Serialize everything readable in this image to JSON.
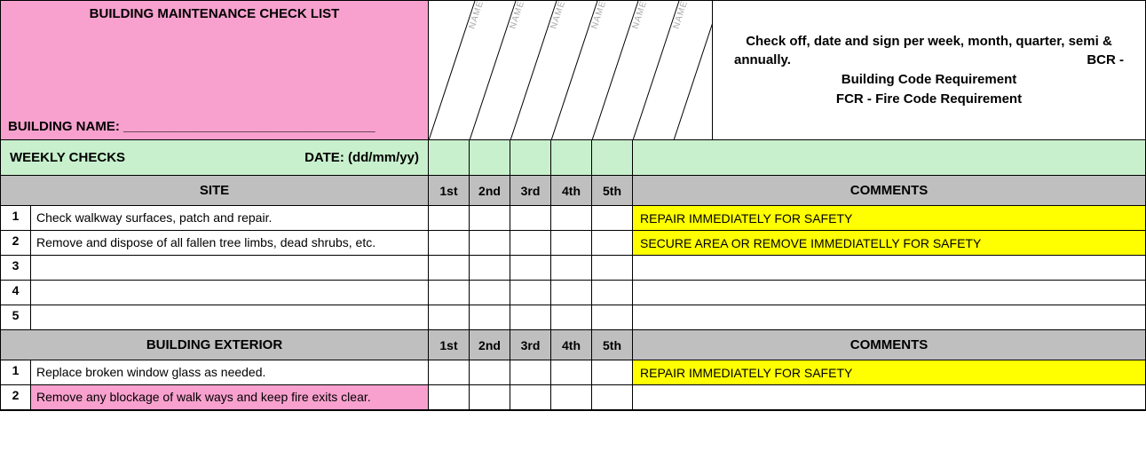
{
  "header": {
    "title": "BUILDING MAINTENANCE CHECK LIST",
    "building_label": "BUILDING NAME: __________________________________",
    "name_label": "NAME",
    "info_line1_left": "Check off, date and sign per week, month, quarter, semi &",
    "info_line2_left": "annually.",
    "info_line2_right": "BCR -",
    "info_line3": "Building Code Requirement",
    "info_line4": "FCR - Fire Code Requirement"
  },
  "weekly": {
    "label": "WEEKLY CHECKS",
    "date_label": "DATE: (dd/mm/yy)"
  },
  "columns": [
    "1st",
    "2nd",
    "3rd",
    "4th",
    "5th"
  ],
  "comments_header": "COMMENTS",
  "sections": [
    {
      "title": "SITE",
      "rows": [
        {
          "num": "1",
          "desc": "Check walkway surfaces, patch and repair.",
          "comment": "REPAIR IMMEDIATELY FOR SAFETY",
          "comment_yellow": true,
          "desc_pink": false
        },
        {
          "num": "2",
          "desc": "Remove and dispose of all fallen tree limbs, dead shrubs, etc.",
          "comment": "SECURE AREA OR REMOVE IMMEDIATELLY FOR SAFETY",
          "comment_yellow": true,
          "desc_pink": false
        },
        {
          "num": "3",
          "desc": "",
          "comment": "",
          "comment_yellow": false,
          "desc_pink": false
        },
        {
          "num": "4",
          "desc": "",
          "comment": "",
          "comment_yellow": false,
          "desc_pink": false
        },
        {
          "num": "5",
          "desc": "",
          "comment": "",
          "comment_yellow": false,
          "desc_pink": false
        }
      ]
    },
    {
      "title": "BUILDING EXTERIOR",
      "rows": [
        {
          "num": "1",
          "desc": "Replace broken window glass as needed.",
          "comment": "REPAIR IMMEDIATELY FOR SAFETY",
          "comment_yellow": true,
          "desc_pink": false
        },
        {
          "num": "2",
          "desc": "Remove any blockage of walk ways and keep fire exits clear.",
          "comment": "",
          "comment_yellow": false,
          "desc_pink": true
        }
      ]
    }
  ]
}
